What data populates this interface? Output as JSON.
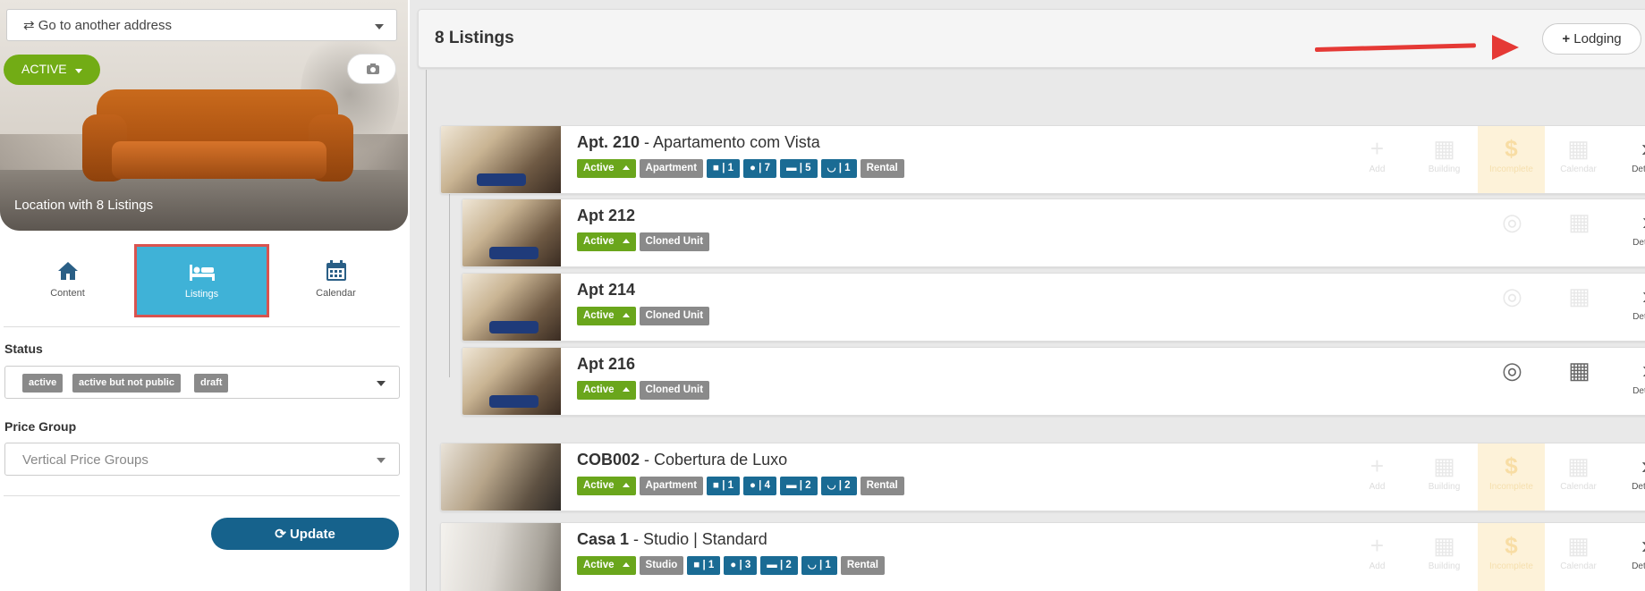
{
  "sidebar": {
    "address_select": "Go to another address",
    "status_button": "ACTIVE",
    "hero_caption": "Location with 8 Listings",
    "tabs": [
      {
        "label": "Content",
        "icon": "home-icon"
      },
      {
        "label": "Listings",
        "icon": "bed-icon",
        "selected": true
      },
      {
        "label": "Calendar",
        "icon": "calendar-icon"
      }
    ],
    "status_label": "Status",
    "status_chips": [
      "active",
      "active but not public",
      "draft"
    ],
    "price_group_label": "Price Group",
    "price_group_placeholder": "Vertical Price Groups",
    "update_button": "Update"
  },
  "header": {
    "title": "8 Listings",
    "lodging_button": "Lodging"
  },
  "actions": {
    "add": "Add",
    "building": "Building",
    "money": "Incomplete",
    "calendar": "Calendar",
    "details": "Details"
  },
  "listings": [
    {
      "code": "Apt. 210",
      "name": " - Apartamento com Vista",
      "status": "Active",
      "type": "Apartment",
      "rooms": "| 1",
      "guests": "| 7",
      "beds": "| 5",
      "baths": "| 1",
      "mode": "Rental"
    },
    {
      "code": "Apt 212",
      "status": "Active",
      "type": "Cloned Unit"
    },
    {
      "code": "Apt 214",
      "status": "Active",
      "type": "Cloned Unit"
    },
    {
      "code": "Apt 216",
      "status": "Active",
      "type": "Cloned Unit"
    },
    {
      "code": "COB002",
      "name": " - Cobertura de Luxo",
      "status": "Active",
      "type": "Apartment",
      "rooms": "| 1",
      "guests": "| 4",
      "beds": "| 2",
      "baths": "| 2",
      "mode": "Rental"
    },
    {
      "code": "Casa 1",
      "name": " - Studio | Standard",
      "status": "Active",
      "type": "Studio",
      "rooms": "| 1",
      "guests": "| 3",
      "beds": "| 2",
      "baths": "| 1",
      "mode": "Rental"
    }
  ],
  "colors": {
    "accent_green": "#72ac15",
    "selected_tab": "#3fb2d7",
    "update_blue": "#16628c",
    "badge_blue": "#1a6b94",
    "arrow_red": "#e53935"
  }
}
